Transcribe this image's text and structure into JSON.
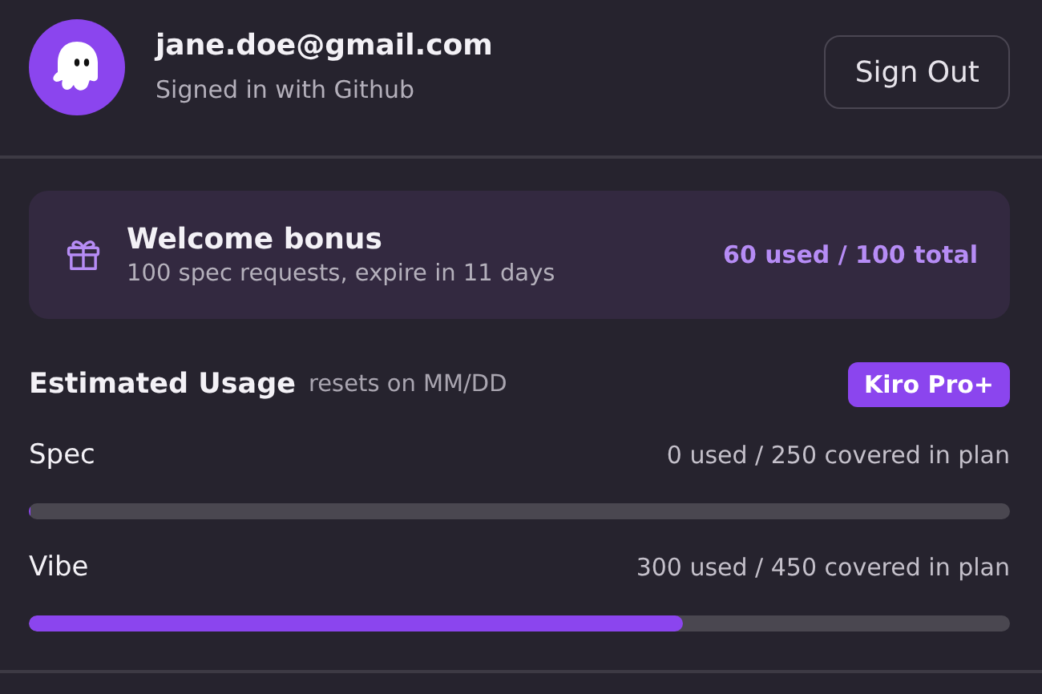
{
  "account": {
    "email": "jane.doe@gmail.com",
    "provider": "Signed in with Github",
    "button": "Sign Out"
  },
  "bonus": {
    "title": "Welcome bonus",
    "description": "100 spec requests, expire in 11 days",
    "usage": "60 used / 100 total"
  },
  "usage": {
    "title": "Estimated Usage",
    "subtitle": "resets on MM/DD",
    "plan": "Kiro Pro+",
    "meters": [
      {
        "name": "Spec",
        "reading": "0 used / 250 covered in plan",
        "level": 0
      },
      {
        "name": "Vibe",
        "reading": "300 used / 450 covered in plan",
        "level": 0.667
      }
    ]
  }
}
